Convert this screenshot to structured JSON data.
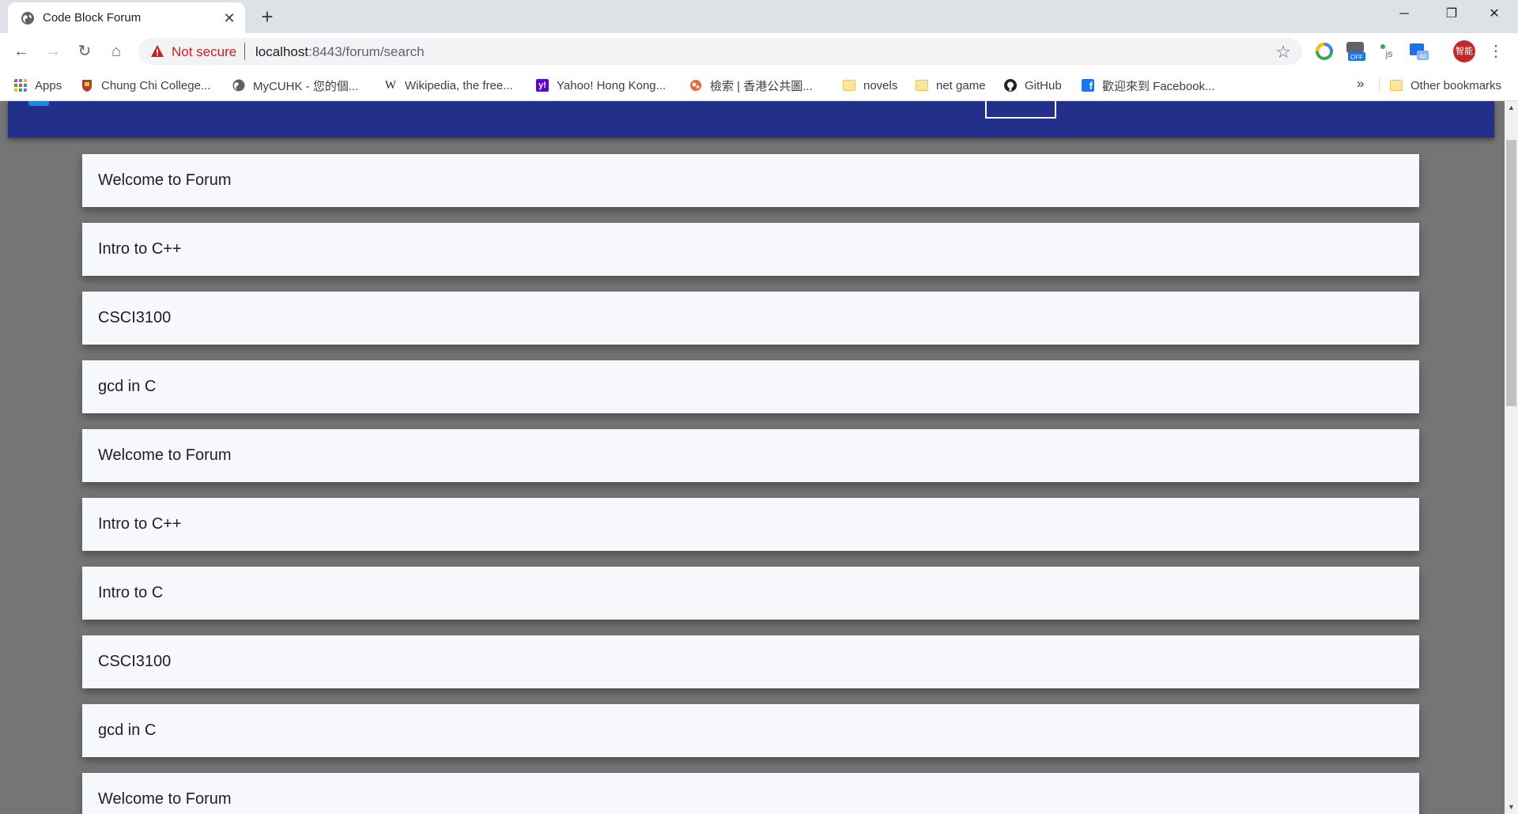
{
  "browser": {
    "tab": {
      "title": "Code Block Forum"
    },
    "address": {
      "security_label": "Not secure",
      "host": "localhost",
      "path": ":8443/forum/search"
    },
    "profile_initials": "智能",
    "bookmarks": [
      {
        "label": "Apps",
        "icon": "apps-grid-icon"
      },
      {
        "label": "Chung Chi College...",
        "icon": "college-crest-icon"
      },
      {
        "label": "MyCUHK - 您的個...",
        "icon": "globe-icon"
      },
      {
        "label": "Wikipedia, the free...",
        "icon": "wikipedia-icon"
      },
      {
        "label": "Yahoo! Hong Kong...",
        "icon": "yahoo-icon"
      },
      {
        "label": "檢索 | 香港公共圖...",
        "icon": "library-icon"
      },
      {
        "label": "novels",
        "icon": "folder-icon"
      },
      {
        "label": "net game",
        "icon": "folder-icon"
      },
      {
        "label": "GitHub",
        "icon": "github-icon"
      },
      {
        "label": "歡迎來到 Facebook...",
        "icon": "facebook-icon"
      }
    ],
    "bookmarks_more": "»",
    "other_bookmarks": "Other bookmarks",
    "colors": {
      "tabstrip": "#dee1e6",
      "warning": "#c5221f"
    }
  },
  "page": {
    "nav_color": "#22308c",
    "posts": [
      {
        "title": "Welcome to Forum"
      },
      {
        "title": "Intro to C++"
      },
      {
        "title": "CSCI3100"
      },
      {
        "title": "gcd in C"
      },
      {
        "title": "Welcome to Forum"
      },
      {
        "title": "Intro to C++"
      },
      {
        "title": "Intro to C"
      },
      {
        "title": "CSCI3100"
      },
      {
        "title": "gcd in C"
      },
      {
        "title": "Welcome to Forum"
      }
    ]
  }
}
